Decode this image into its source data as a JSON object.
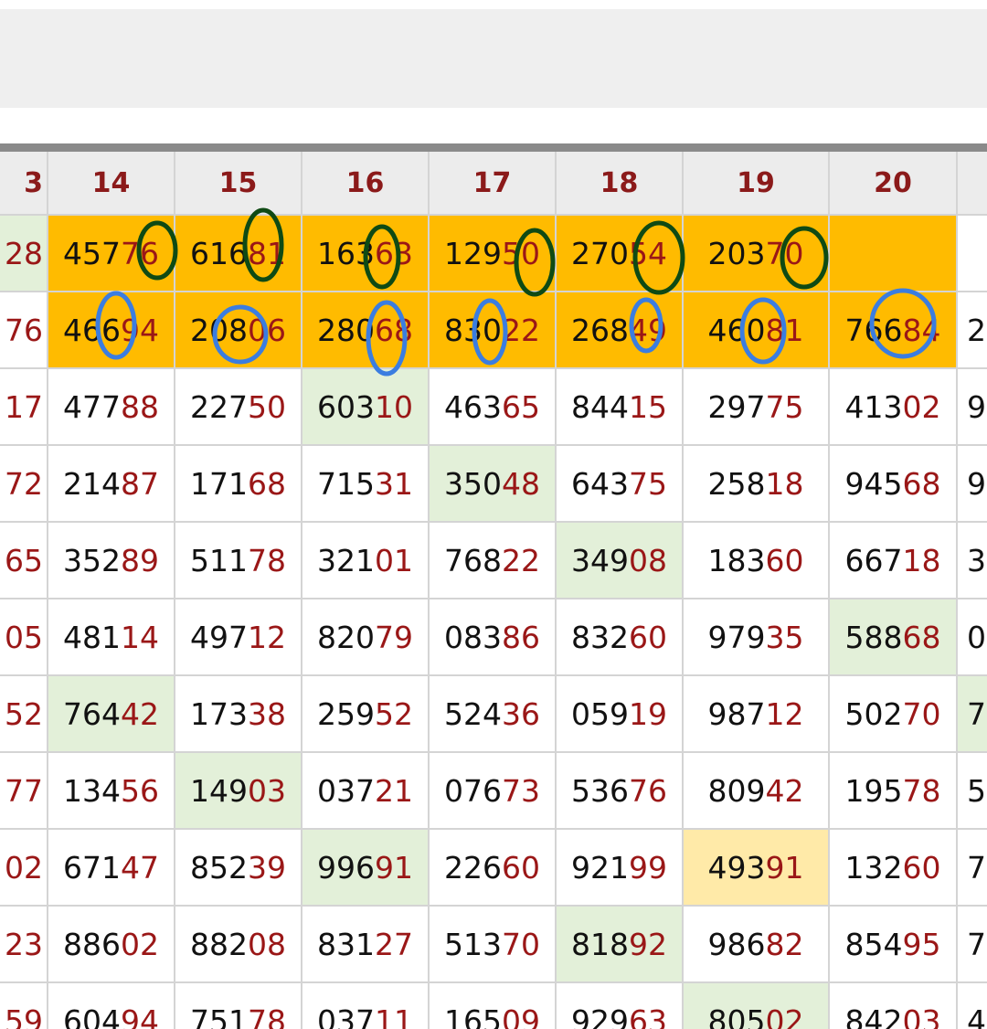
{
  "header_row": [
    {
      "text": "3"
    },
    {
      "text": "14"
    },
    {
      "text": "15"
    },
    {
      "text": "16"
    },
    {
      "text": "17"
    },
    {
      "text": "18"
    },
    {
      "text": "19"
    },
    {
      "text": "20"
    },
    {
      "text": ""
    }
  ],
  "rows": [
    {
      "cells": [
        {
          "a": "",
          "b": "28",
          "bg": "green"
        },
        {
          "a": "457",
          "b": "76",
          "bg": "orange"
        },
        {
          "a": "616",
          "b": "81",
          "bg": "orange"
        },
        {
          "a": "163",
          "b": "63",
          "bg": "orange"
        },
        {
          "a": "129",
          "b": "50",
          "bg": "orange"
        },
        {
          "a": "270",
          "b": "54",
          "bg": "orange"
        },
        {
          "a": "203",
          "b": "70",
          "bg": "orange"
        },
        {
          "a": "",
          "b": "",
          "bg": "orange"
        },
        {
          "a": "",
          "b": "",
          "bg": "white"
        }
      ]
    },
    {
      "cells": [
        {
          "a": "",
          "b": "76",
          "bg": "white"
        },
        {
          "a": "466",
          "b": "94",
          "bg": "orange"
        },
        {
          "a": "208",
          "b": "06",
          "bg": "orange"
        },
        {
          "a": "280",
          "b": "68",
          "bg": "orange"
        },
        {
          "a": "830",
          "b": "22",
          "bg": "orange"
        },
        {
          "a": "268",
          "b": "49",
          "bg": "orange"
        },
        {
          "a": "460",
          "b": "81",
          "bg": "orange"
        },
        {
          "a": "766",
          "b": "84",
          "bg": "orange"
        },
        {
          "a": "2",
          "b": "",
          "bg": "white"
        }
      ]
    },
    {
      "cells": [
        {
          "a": "",
          "b": "17",
          "bg": "white"
        },
        {
          "a": "477",
          "b": "88",
          "bg": "white"
        },
        {
          "a": "227",
          "b": "50",
          "bg": "white"
        },
        {
          "a": "603",
          "b": "10",
          "bg": "green"
        },
        {
          "a": "463",
          "b": "65",
          "bg": "white"
        },
        {
          "a": "844",
          "b": "15",
          "bg": "white"
        },
        {
          "a": "297",
          "b": "75",
          "bg": "white"
        },
        {
          "a": "413",
          "b": "02",
          "bg": "white"
        },
        {
          "a": "9",
          "b": "",
          "bg": "white"
        }
      ]
    },
    {
      "cells": [
        {
          "a": "",
          "b": "72",
          "bg": "white"
        },
        {
          "a": "214",
          "b": "87",
          "bg": "white"
        },
        {
          "a": "171",
          "b": "68",
          "bg": "white"
        },
        {
          "a": "715",
          "b": "31",
          "bg": "white"
        },
        {
          "a": "350",
          "b": "48",
          "bg": "green"
        },
        {
          "a": "643",
          "b": "75",
          "bg": "white"
        },
        {
          "a": "258",
          "b": "18",
          "bg": "white"
        },
        {
          "a": "945",
          "b": "68",
          "bg": "white"
        },
        {
          "a": "9",
          "b": "",
          "bg": "white"
        }
      ]
    },
    {
      "cells": [
        {
          "a": "",
          "b": "65",
          "bg": "white"
        },
        {
          "a": "352",
          "b": "89",
          "bg": "white"
        },
        {
          "a": "511",
          "b": "78",
          "bg": "white"
        },
        {
          "a": "321",
          "b": "01",
          "bg": "white"
        },
        {
          "a": "768",
          "b": "22",
          "bg": "white"
        },
        {
          "a": "349",
          "b": "08",
          "bg": "green"
        },
        {
          "a": "183",
          "b": "60",
          "bg": "white"
        },
        {
          "a": "667",
          "b": "18",
          "bg": "white"
        },
        {
          "a": "3",
          "b": "",
          "bg": "white"
        }
      ]
    },
    {
      "cells": [
        {
          "a": "",
          "b": "05",
          "bg": "white"
        },
        {
          "a": "481",
          "b": "14",
          "bg": "white"
        },
        {
          "a": "497",
          "b": "12",
          "bg": "white"
        },
        {
          "a": "820",
          "b": "79",
          "bg": "white"
        },
        {
          "a": "083",
          "b": "86",
          "bg": "white"
        },
        {
          "a": "832",
          "b": "60",
          "bg": "white"
        },
        {
          "a": "979",
          "b": "35",
          "bg": "white"
        },
        {
          "a": "588",
          "b": "68",
          "bg": "green"
        },
        {
          "a": "0",
          "b": "",
          "bg": "white"
        }
      ]
    },
    {
      "cells": [
        {
          "a": "",
          "b": "52",
          "bg": "white"
        },
        {
          "a": "764",
          "b": "42",
          "bg": "green"
        },
        {
          "a": "173",
          "b": "38",
          "bg": "white"
        },
        {
          "a": "259",
          "b": "52",
          "bg": "white"
        },
        {
          "a": "524",
          "b": "36",
          "bg": "white"
        },
        {
          "a": "059",
          "b": "19",
          "bg": "white"
        },
        {
          "a": "987",
          "b": "12",
          "bg": "white"
        },
        {
          "a": "502",
          "b": "70",
          "bg": "white"
        },
        {
          "a": "7",
          "b": "",
          "bg": "green"
        }
      ]
    },
    {
      "cells": [
        {
          "a": "",
          "b": "77",
          "bg": "white"
        },
        {
          "a": "134",
          "b": "56",
          "bg": "white"
        },
        {
          "a": "149",
          "b": "03",
          "bg": "green"
        },
        {
          "a": "037",
          "b": "21",
          "bg": "white"
        },
        {
          "a": "076",
          "b": "73",
          "bg": "white"
        },
        {
          "a": "536",
          "b": "76",
          "bg": "white"
        },
        {
          "a": "809",
          "b": "42",
          "bg": "white"
        },
        {
          "a": "195",
          "b": "78",
          "bg": "white"
        },
        {
          "a": "5",
          "b": "",
          "bg": "white"
        }
      ]
    },
    {
      "cells": [
        {
          "a": "",
          "b": "02",
          "bg": "white"
        },
        {
          "a": "671",
          "b": "47",
          "bg": "white"
        },
        {
          "a": "852",
          "b": "39",
          "bg": "white"
        },
        {
          "a": "996",
          "b": "91",
          "bg": "green"
        },
        {
          "a": "226",
          "b": "60",
          "bg": "white"
        },
        {
          "a": "921",
          "b": "99",
          "bg": "white"
        },
        {
          "a": "493",
          "b": "91",
          "bg": "yellow"
        },
        {
          "a": "132",
          "b": "60",
          "bg": "white"
        },
        {
          "a": "7",
          "b": "",
          "bg": "white"
        }
      ]
    },
    {
      "cells": [
        {
          "a": "",
          "b": "23",
          "bg": "white"
        },
        {
          "a": "886",
          "b": "02",
          "bg": "white"
        },
        {
          "a": "882",
          "b": "08",
          "bg": "white"
        },
        {
          "a": "831",
          "b": "27",
          "bg": "white"
        },
        {
          "a": "513",
          "b": "70",
          "bg": "white"
        },
        {
          "a": "818",
          "b": "92",
          "bg": "green"
        },
        {
          "a": "986",
          "b": "82",
          "bg": "white"
        },
        {
          "a": "854",
          "b": "95",
          "bg": "white"
        },
        {
          "a": "7",
          "b": "",
          "bg": "white"
        }
      ]
    },
    {
      "cells": [
        {
          "a": "",
          "b": "59",
          "bg": "white"
        },
        {
          "a": "604",
          "b": "94",
          "bg": "white"
        },
        {
          "a": "751",
          "b": "78",
          "bg": "white"
        },
        {
          "a": "037",
          "b": "11",
          "bg": "white"
        },
        {
          "a": "165",
          "b": "09",
          "bg": "white"
        },
        {
          "a": "929",
          "b": "63",
          "bg": "white"
        },
        {
          "a": "805",
          "b": "02",
          "bg": "green"
        },
        {
          "a": "842",
          "b": "03",
          "bg": "white"
        },
        {
          "a": "4",
          "b": "",
          "bg": "white"
        }
      ]
    }
  ],
  "annotation_colors": {
    "green_ring": "#0f4a14",
    "blue_ring": "#3b7de0"
  }
}
